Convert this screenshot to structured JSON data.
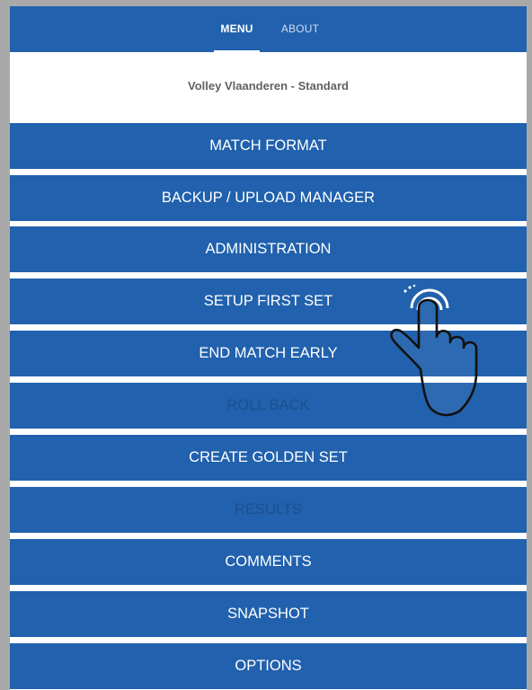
{
  "tabs": {
    "menu_label": "MENU",
    "about_label": "ABOUT"
  },
  "header": {
    "subtitle": "Volley Vlaanderen - Standard"
  },
  "menu": {
    "items": [
      {
        "label": "MATCH FORMAT",
        "enabled": true
      },
      {
        "label": "BACKUP / UPLOAD MANAGER",
        "enabled": true
      },
      {
        "label": "ADMINISTRATION",
        "enabled": true
      },
      {
        "label": "SETUP FIRST SET",
        "enabled": true
      },
      {
        "label": "END MATCH EARLY",
        "enabled": true
      },
      {
        "label": "ROLL BACK",
        "enabled": false
      },
      {
        "label": "CREATE GOLDEN SET",
        "enabled": true
      },
      {
        "label": "RESULTS",
        "enabled": false
      },
      {
        "label": "COMMENTS",
        "enabled": true
      },
      {
        "label": "SNAPSHOT",
        "enabled": true
      },
      {
        "label": "OPTIONS",
        "enabled": true
      }
    ]
  },
  "colors": {
    "primary": "#2161ad",
    "disabled_text": "#1c4f8f",
    "subtitle_text": "#616161",
    "background": "#a9a9a9"
  },
  "overlay": {
    "icon": "tap-hand-icon"
  }
}
